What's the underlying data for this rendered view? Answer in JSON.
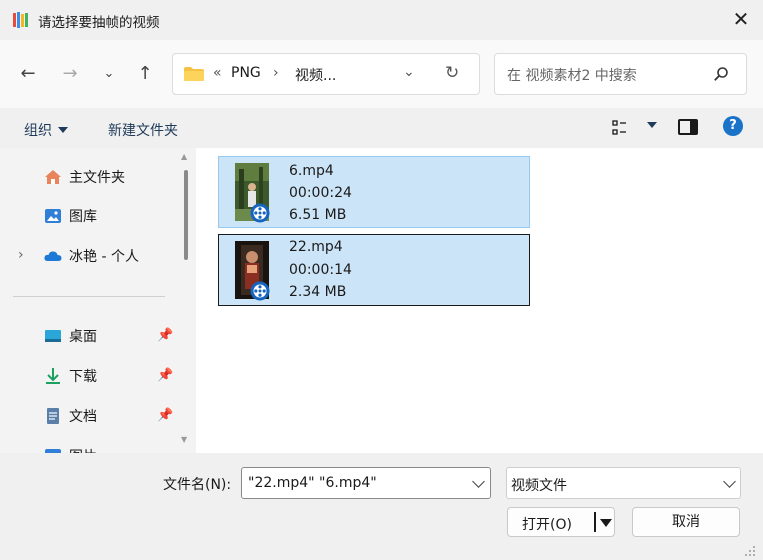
{
  "window": {
    "title": "请选择要抽帧的视频",
    "close_icon": "close-icon"
  },
  "nav": {
    "back_icon": "arrow-left-icon",
    "forward_icon": "arrow-right-icon",
    "recent_icon": "chevron-down-icon",
    "up_icon": "arrow-up-icon",
    "address": {
      "overflow": "«",
      "crumb1": "PNG",
      "separator": "›",
      "crumb2": "视频..."
    },
    "search_placeholder": "在 视频素材2 中搜索"
  },
  "commands": {
    "organize": "组织",
    "new_folder": "新建文件夹"
  },
  "sidebar": {
    "items": [
      {
        "label": "主文件夹",
        "icon": "home-icon"
      },
      {
        "label": "图库",
        "icon": "gallery-icon"
      },
      {
        "label": "冰艳 - 个人",
        "icon": "cloud-icon",
        "expandable": true
      }
    ],
    "quick": [
      {
        "label": "桌面",
        "icon": "desktop-icon",
        "pinned": true
      },
      {
        "label": "下载",
        "icon": "download-icon",
        "pinned": true
      },
      {
        "label": "文档",
        "icon": "document-icon",
        "pinned": true
      },
      {
        "label": "图片",
        "icon": "pictures-icon",
        "pinned": true
      }
    ]
  },
  "files": [
    {
      "name": "6.mp4",
      "duration": "00:00:24",
      "size": "6.51 MB",
      "selected": true
    },
    {
      "name": "22.mp4",
      "duration": "00:00:14",
      "size": "2.34 MB",
      "selected": true,
      "focused": true
    }
  ],
  "footer": {
    "filename_label": "文件名(N):",
    "filename_value": "\"22.mp4\" \"6.mp4\"",
    "filetype_value": "视频文件",
    "open_label": "打开(O)",
    "cancel_label": "取消"
  },
  "colors": {
    "selection": "#cce4f7",
    "selection_border": "#99c9ef",
    "accent": "#1a73c9"
  }
}
